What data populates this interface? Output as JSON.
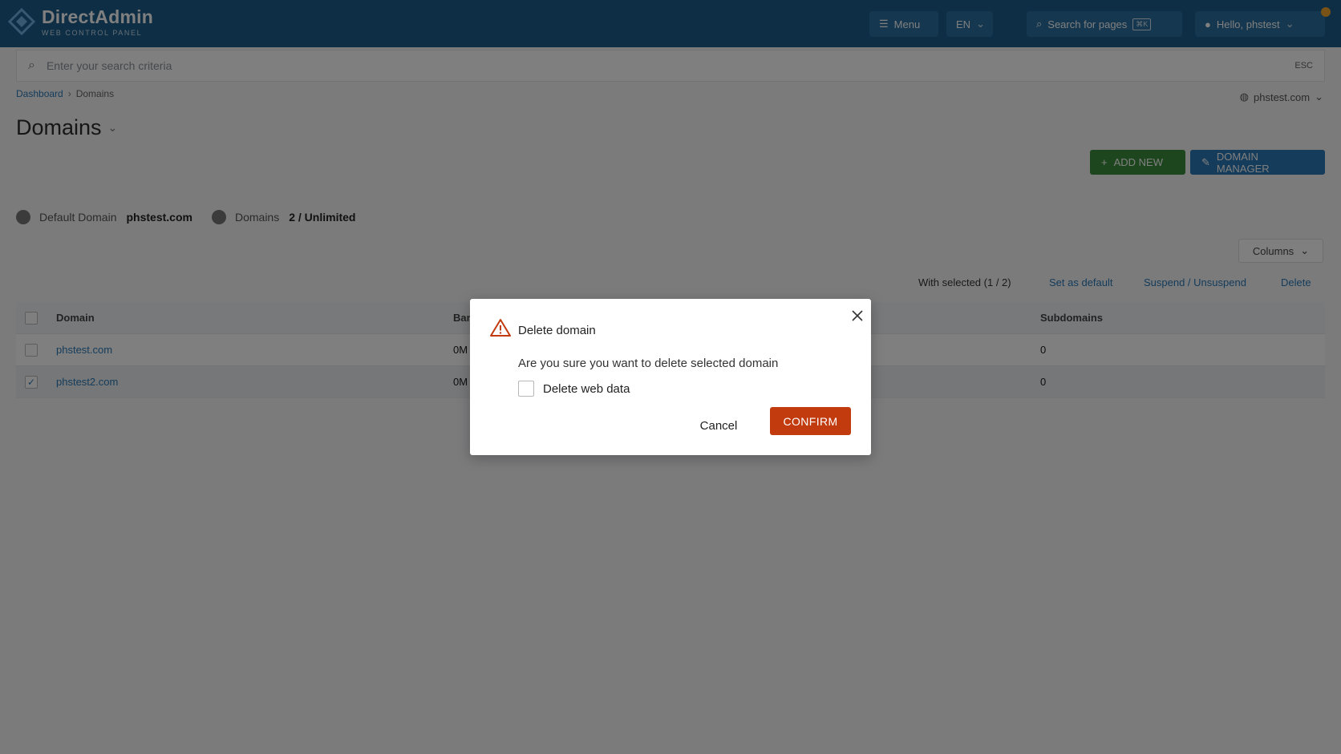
{
  "topbar": {
    "logo_title": "DirectAdmin",
    "logo_subtitle": "WEB CONTROL PANEL",
    "menu_label": "Menu",
    "lang_label": "EN",
    "search_pages_label": "Search for pages",
    "search_shortcut": "⌘K",
    "user_label": "Hello, phstest"
  },
  "search": {
    "placeholder": "Enter your search criteria",
    "hint": "ESC"
  },
  "breadcrumb": {
    "home": "Dashboard",
    "current": "Domains"
  },
  "account_selector": "phstest.com",
  "page_title": "Domains",
  "actions": {
    "add": "ADD NEW",
    "manager": "DOMAIN MANAGER"
  },
  "stats": {
    "default_label": "Default Domain",
    "default_value": "phstest.com",
    "domains_label": "Domains",
    "domains_value": "2 / Unlimited"
  },
  "columns_label": "Columns",
  "bulk": {
    "with_selected": "With selected (1 / 2)",
    "set_default": "Set as default",
    "suspend": "Suspend / Unsuspend",
    "delete": "Delete"
  },
  "table": {
    "headers": [
      "Domain",
      "Bandwidth",
      "Subdomains"
    ],
    "rows": [
      {
        "domain": "phstest.com",
        "bandwidth": "0M",
        "subdomains": "0",
        "selected": false
      },
      {
        "domain": "phstest2.com",
        "bandwidth": "0M",
        "subdomains": "0",
        "selected": true
      }
    ]
  },
  "modal": {
    "title": "Delete domain",
    "message": "Are you sure you want to delete selected domain",
    "checkbox_label": "Delete web data",
    "cancel": "Cancel",
    "confirm": "CONFIRM"
  },
  "colors": {
    "topbar": "#1d5d8a",
    "confirm": "#c23b0f",
    "warning": "#c23b0f",
    "link": "#2a78b5",
    "add_button": "#3b8a3c"
  }
}
